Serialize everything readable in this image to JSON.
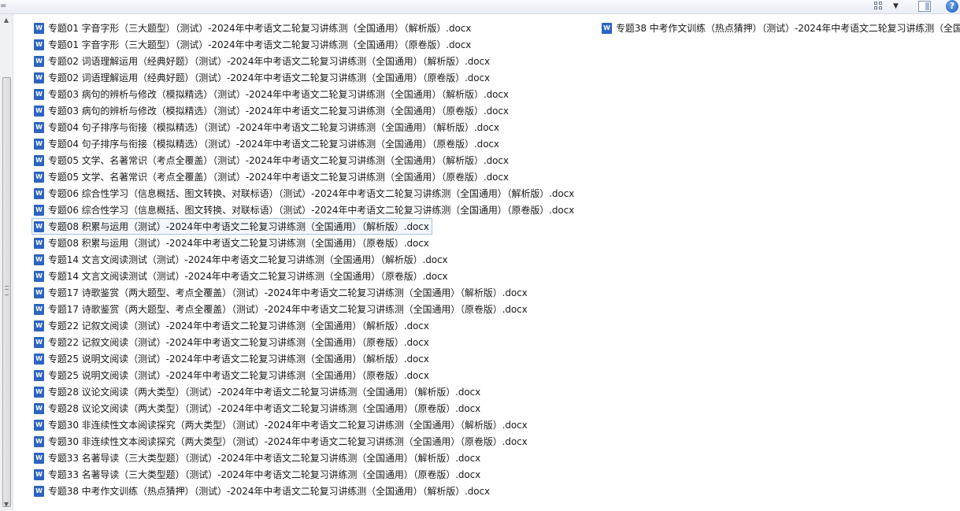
{
  "toolbar": {
    "left_glyph": "=",
    "caret_glyph": "▼",
    "help_glyph": "?"
  },
  "files": [
    "专题01 字音字形（三大题型）（测试）-2024年中考语文二轮复习讲练测（全国通用）（解析版）.docx",
    "专题01 字音字形（三大题型）（测试）-2024年中考语文二轮复习讲练测（全国通用）（原卷版）.docx",
    "专题02 词语理解运用（经典好题）（测试）-2024年中考语文二轮复习讲练测（全国通用）（解析版）.docx",
    "专题02 词语理解运用（经典好题）（测试）-2024年中考语文二轮复习讲练测（全国通用）（原卷版）.docx",
    "专题03 病句的辨析与修改（模拟精选）（测试）-2024年中考语文二轮复习讲练测（全国通用）（解析版）.docx",
    "专题03 病句的辨析与修改（模拟精选）（测试）-2024年中考语文二轮复习讲练测（全国通用）（原卷版）.docx",
    "专题04 句子排序与衔接（模拟精选）（测试）-2024年中考语文二轮复习讲练测（全国通用）（解析版）.docx",
    "专题04 句子排序与衔接（模拟精选）（测试）-2024年中考语文二轮复习讲练测（全国通用）（原卷版）.docx",
    "专题05 文学、名著常识（考点全覆盖）（测试）-2024年中考语文二轮复习讲练测（全国通用）（解析版）.docx",
    "专题05 文学、名著常识（考点全覆盖）（测试）-2024年中考语文二轮复习讲练测（全国通用）（原卷版）.docx",
    "专题06 综合性学习（信息概括、图文转换、对联标语）（测试）-2024年中考语文二轮复习讲练测（全国通用）（解析版）.docx",
    "专题06 综合性学习（信息概括、图文转换、对联标语）（测试）-2024年中考语文二轮复习讲练测（全国通用）（原卷版）.docx",
    "专题08 积累与运用（测试）-2024年中考语文二轮复习讲练测（全国通用）（解析版）.docx",
    "专题08 积累与运用（测试）-2024年中考语文二轮复习讲练测（全国通用）（原卷版）.docx",
    "专题14 文言文阅读测试（测试）-2024年中考语文二轮复习讲练测（全国通用）（解析版）.docx",
    "专题14 文言文阅读测试（测试）-2024年中考语文二轮复习讲练测（全国通用）（原卷版）.docx",
    "专题17 诗歌鉴赏（两大题型、考点全覆盖）（测试）-2024年中考语文二轮复习讲练测（全国通用）（解析版）.docx",
    "专题17 诗歌鉴赏（两大题型、考点全覆盖）（测试）-2024年中考语文二轮复习讲练测（全国通用）（原卷版）.docx",
    "专题22 记叙文阅读（测试）-2024年中考语文二轮复习讲练测（全国通用）（解析版）.docx",
    "专题22 记叙文阅读（测试）-2024年中考语文二轮复习讲练测（全国通用）（原卷版）.docx",
    "专题25 说明文阅读（测试）-2024年中考语文二轮复习讲练测（全国通用）（解析版）.docx",
    "专题25 说明文阅读（测试）-2024年中考语文二轮复习讲练测（全国通用）（原卷版）.docx",
    "专题28 议论文阅读（两大类型）（测试）-2024年中考语文二轮复习讲练测（全国通用）（解析版）.docx",
    "专题28 议论文阅读（两大类型）（测试）-2024年中考语文二轮复习讲练测（全国通用）（原卷版）.docx",
    "专题30 非连续性文本阅读探究（两大类型）（测试）-2024年中考语文二轮复习讲练测（全国通用）（解析版）.docx",
    "专题30 非连续性文本阅读探究（两大类型）（测试）-2024年中考语文二轮复习讲练测（全国通用）（原卷版）.docx",
    "专题33 名著导读（三大类型题）（测试）-2024年中考语文二轮复习讲练测（全国通用）（解析版）.docx",
    "专题33 名著导读（三大类型题）（测试）-2024年中考语文二轮复习讲练测（全国通用）（原卷版）.docx",
    "专题38 中考作文训练（热点猜押）（测试）-2024年中考语文二轮复习讲练测（全国通用）（解析版）.docx"
  ],
  "files_col2": [
    "专题38 中考作文训练（热点猜押）（测试）-2024年中考语文二轮复习讲练测（全国"
  ],
  "selected_index": 12,
  "icon": "word-docx-icon"
}
